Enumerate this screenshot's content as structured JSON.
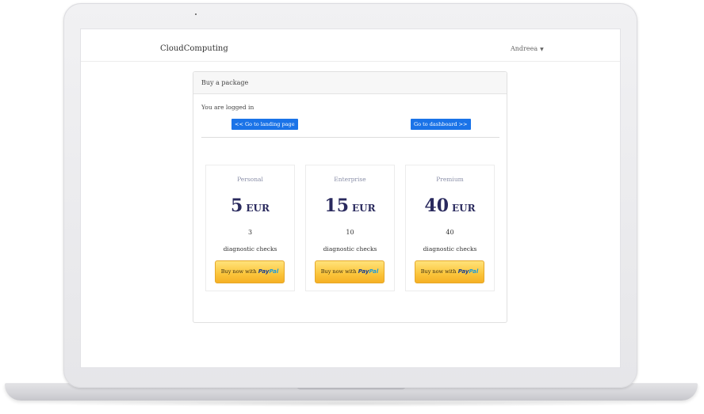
{
  "navbar": {
    "brand": "CloudComputing",
    "user": "Andreea",
    "caret": "▼"
  },
  "card": {
    "header": "Buy a package",
    "status": "You are logged in",
    "landing_button": "<< Go to landing page",
    "dashboard_button": "Go to dashboard >>"
  },
  "plans": [
    {
      "name": "Personal",
      "price": "5",
      "currency": "EUR",
      "checks": "3",
      "checks_label": "diagnostic checks",
      "buy_prefix": "Buy now with",
      "brand_a": "Pay",
      "brand_b": "Pal"
    },
    {
      "name": "Enterprise",
      "price": "15",
      "currency": "EUR",
      "checks": "10",
      "checks_label": "diagnostic checks",
      "buy_prefix": "Buy now with",
      "brand_a": "Pay",
      "brand_b": "Pal"
    },
    {
      "name": "Premium",
      "price": "40",
      "currency": "EUR",
      "checks": "40",
      "checks_label": "diagnostic checks",
      "buy_prefix": "Buy now with",
      "brand_a": "Pay",
      "brand_b": "Pal"
    }
  ],
  "colors": {
    "primary_button": "#1a73e8",
    "price_text": "#2a2a5e",
    "paypal_gold": "#fbc53b"
  }
}
